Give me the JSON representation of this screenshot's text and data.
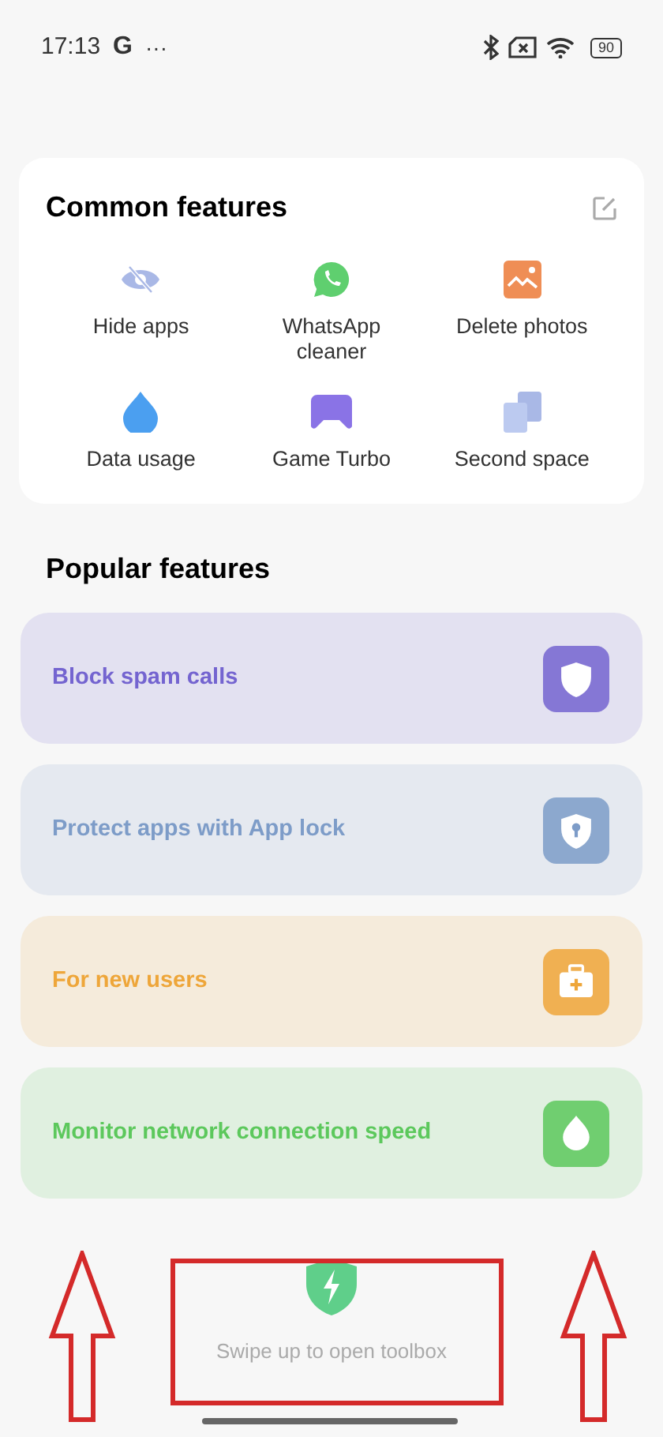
{
  "status_bar": {
    "time": "17:13",
    "app_letter": "G",
    "more": "···",
    "battery": "90"
  },
  "common_features": {
    "title": "Common features",
    "items": [
      {
        "label": "Hide apps",
        "kind": "hide"
      },
      {
        "label": "WhatsApp cleaner",
        "kind": "chat"
      },
      {
        "label": "Delete photos",
        "kind": "photo"
      },
      {
        "label": "Data usage",
        "kind": "drop"
      },
      {
        "label": "Game Turbo",
        "kind": "game"
      },
      {
        "label": "Second space",
        "kind": "space"
      }
    ]
  },
  "popular_features": {
    "title": "Popular features",
    "items": [
      {
        "label": "Block spam calls",
        "kind": "shield",
        "color": "#7464d0"
      },
      {
        "label": "Protect apps with App lock",
        "kind": "lock",
        "color": "#7d9cc8"
      },
      {
        "label": "For new users",
        "kind": "kit",
        "color": "#eea63a"
      },
      {
        "label": "Monitor network connection speed",
        "kind": "drop",
        "color": "#5cc85c"
      }
    ]
  },
  "toolbox_hint": {
    "text": "Swipe up to open toolbox"
  }
}
